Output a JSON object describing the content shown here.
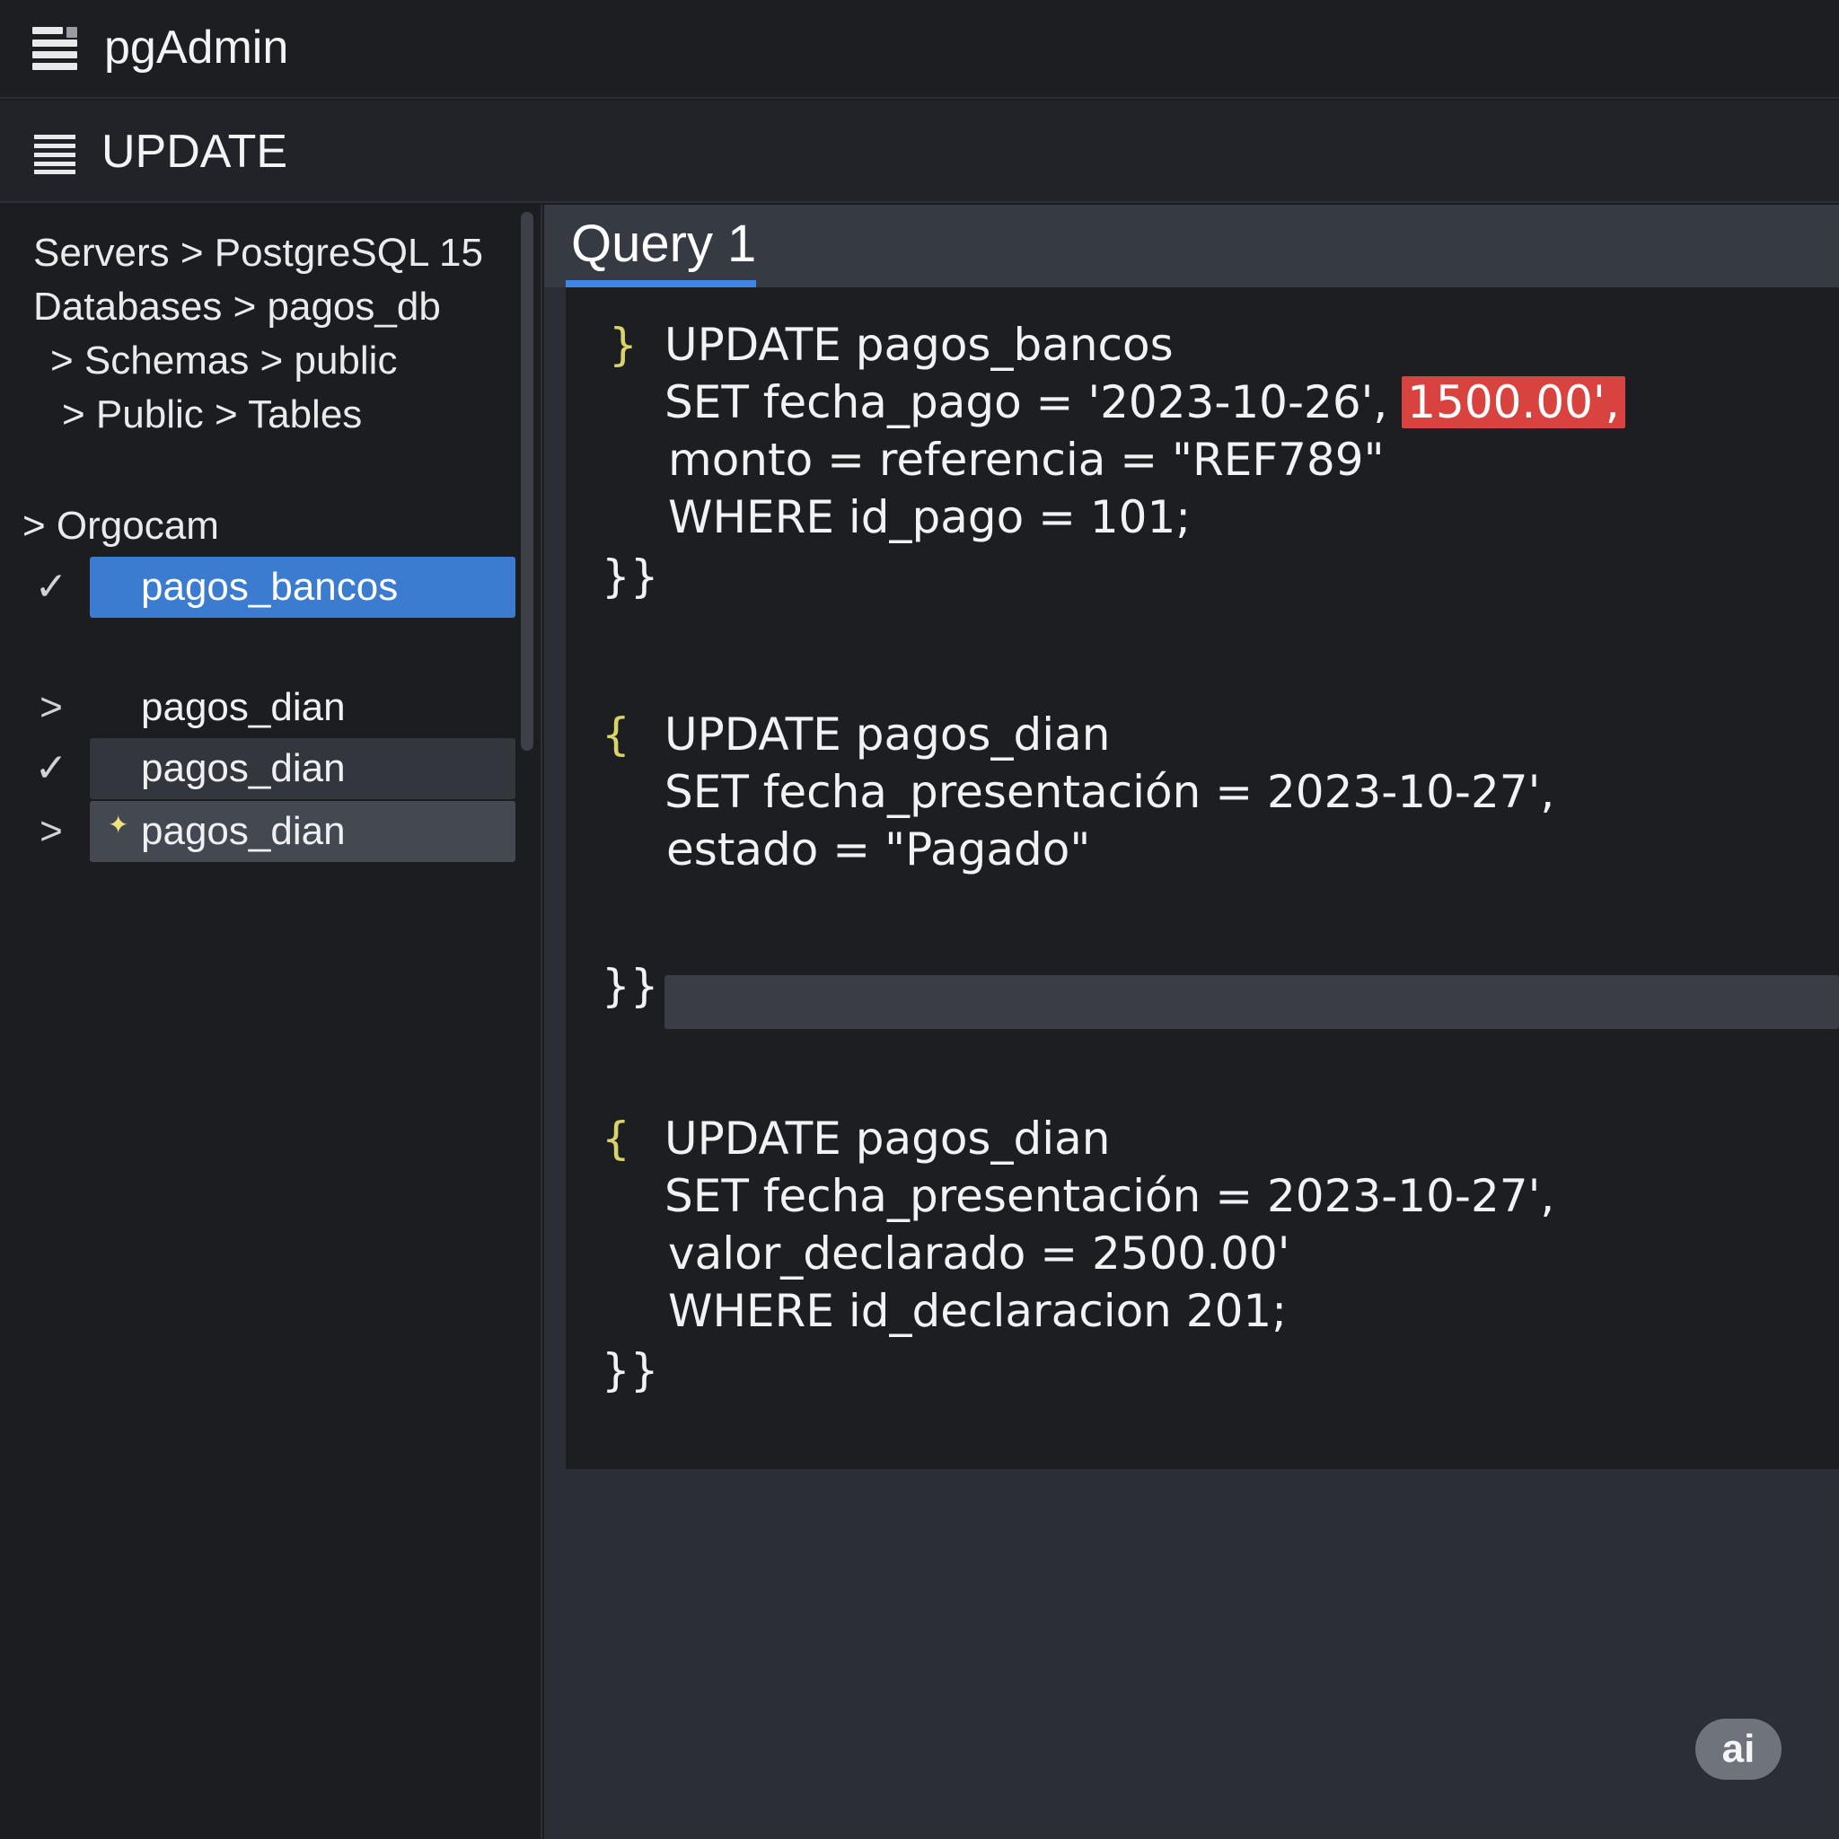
{
  "app": {
    "title": "pgAdmin",
    "icon": "table-icon"
  },
  "menubar": {
    "title": "UPDATE",
    "icon": "hamburger-icon"
  },
  "sidebar": {
    "breadcrumb": [
      "Servers > PostgreSQL 15",
      "Databases > pagos_db",
      "> Schemas > public",
      "> Public > Tables"
    ],
    "group": "> Orgocam",
    "items": [
      {
        "marker": "✓",
        "label": "pagos_bancos",
        "state": "selected"
      },
      {
        "marker": ">",
        "label": "pagos_dian",
        "state": "normal"
      },
      {
        "marker": "✓",
        "label": "pagos_dian",
        "state": "hover"
      },
      {
        "marker": ">",
        "label": "pagos_dian",
        "state": "active"
      }
    ]
  },
  "tabs": [
    {
      "label": "Query 1",
      "active": true
    }
  ],
  "editor": {
    "blocks": [
      {
        "open": "}",
        "lines": [
          "UPDATE pagos_bancos",
          "SET fecha_pago = '2023-10-26',",
          "monto = referencia = \"REF789\"",
          "WHERE id_pago = 101;"
        ],
        "highlight": "1500.00',",
        "close": "}}"
      },
      {
        "open": "{",
        "lines": [
          "UPDATE pagos_dian",
          "SET fecha_presentación = 2023-10-27',",
          "estado = \"Pagado\""
        ],
        "close": "}}"
      },
      {
        "open": "{",
        "lines": [
          "UPDATE pagos_dian",
          "SET fecha_presentación = 2023-10-27',",
          "valor_declarado = 2500.00'",
          "WHERE id_declaracion 201;"
        ],
        "close": "}}"
      }
    ]
  },
  "badge": {
    "label": "ai"
  },
  "colors": {
    "accent": "#3b7bd0",
    "tab_underline": "#3d86e6",
    "highlight_red": "#d9433f",
    "brace_yellow": "#d9d36a"
  }
}
